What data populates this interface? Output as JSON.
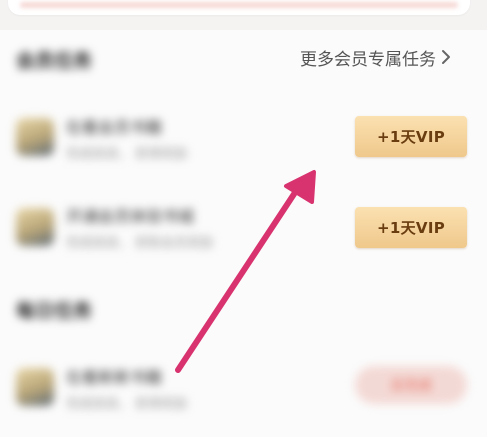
{
  "header": {
    "vip_section_title": "会员任务",
    "more_link_label": "更多会员专属任务",
    "daily_section_title": "每日任务"
  },
  "vip_tasks": [
    {
      "icon": "task-book-icon",
      "title": "在看会员书籍",
      "subtitle": "完成阅读，  获得奖励",
      "reward_label": "+1天VIP"
    },
    {
      "icon": "task-book-icon",
      "title": "开通会员体验书城",
      "subtitle": "完成阅读，  获取会员奖励",
      "reward_label": "+1天VIP"
    }
  ],
  "daily_tasks": [
    {
      "icon": "task-book-icon",
      "title": "在看新新书籍",
      "subtitle": "完成阅读，  获得奖励",
      "action_label": "去完成"
    }
  ],
  "annotation": {
    "arrow_color": "#d8336e"
  },
  "theme": {
    "vip_button_gradient_top": "#fbe1b1",
    "vip_button_gradient_bottom": "#efc88b",
    "vip_button_text": "#6a3d10"
  }
}
